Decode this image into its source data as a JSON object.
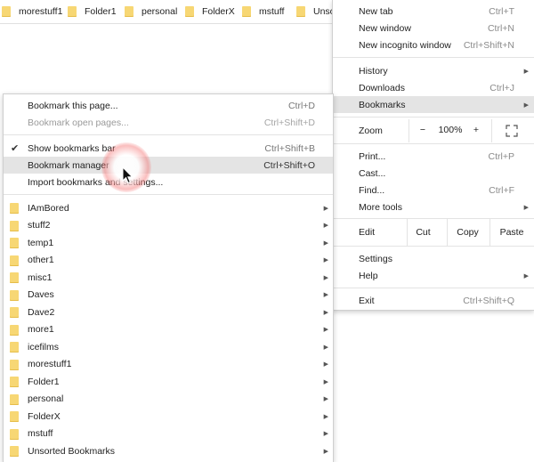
{
  "bookmarks_bar": {
    "items": [
      {
        "label": "morestuff1"
      },
      {
        "label": "Folder1"
      },
      {
        "label": "personal"
      },
      {
        "label": "FolderX"
      },
      {
        "label": "mstuff"
      },
      {
        "label": "Unso"
      }
    ]
  },
  "main_menu": {
    "new_tab": {
      "label": "New tab",
      "shortcut": "Ctrl+T"
    },
    "new_window": {
      "label": "New window",
      "shortcut": "Ctrl+N"
    },
    "new_incognito": {
      "label": "New incognito window",
      "shortcut": "Ctrl+Shift+N"
    },
    "history": {
      "label": "History"
    },
    "downloads": {
      "label": "Downloads",
      "shortcut": "Ctrl+J"
    },
    "bookmarks": {
      "label": "Bookmarks"
    },
    "zoom": {
      "label": "Zoom",
      "minus": "−",
      "value": "100%",
      "plus": "+"
    },
    "print": {
      "label": "Print...",
      "shortcut": "Ctrl+P"
    },
    "cast": {
      "label": "Cast..."
    },
    "find": {
      "label": "Find...",
      "shortcut": "Ctrl+F"
    },
    "more_tools": {
      "label": "More tools"
    },
    "edit": {
      "label": "Edit",
      "cut": "Cut",
      "copy": "Copy",
      "paste": "Paste"
    },
    "settings": {
      "label": "Settings"
    },
    "help": {
      "label": "Help"
    },
    "exit": {
      "label": "Exit",
      "shortcut": "Ctrl+Shift+Q"
    }
  },
  "bookmarks_menu": {
    "bookmark_page": {
      "label": "Bookmark this page...",
      "shortcut": "Ctrl+D"
    },
    "bookmark_open_pages": {
      "label": "Bookmark open pages...",
      "shortcut": "Ctrl+Shift+D"
    },
    "show_bar": {
      "label": "Show bookmarks bar",
      "shortcut": "Ctrl+Shift+B",
      "checked": true
    },
    "manager": {
      "label": "Bookmark manager",
      "shortcut": "Ctrl+Shift+O"
    },
    "import": {
      "label": "Import bookmarks and settings..."
    },
    "folders": [
      {
        "label": "IAmBored"
      },
      {
        "label": "stuff2"
      },
      {
        "label": "temp1"
      },
      {
        "label": "other1"
      },
      {
        "label": "misc1"
      },
      {
        "label": "Daves"
      },
      {
        "label": "Dave2"
      },
      {
        "label": "more1"
      },
      {
        "label": "icefilms"
      },
      {
        "label": "morestuff1"
      },
      {
        "label": "Folder1"
      },
      {
        "label": "personal"
      },
      {
        "label": "FolderX"
      },
      {
        "label": "mstuff"
      },
      {
        "label": "Unsorted Bookmarks"
      }
    ]
  },
  "colors": {
    "folder": "#f7d774",
    "highlight": "#e4e4e4",
    "click_glow": "#f46e6e"
  }
}
